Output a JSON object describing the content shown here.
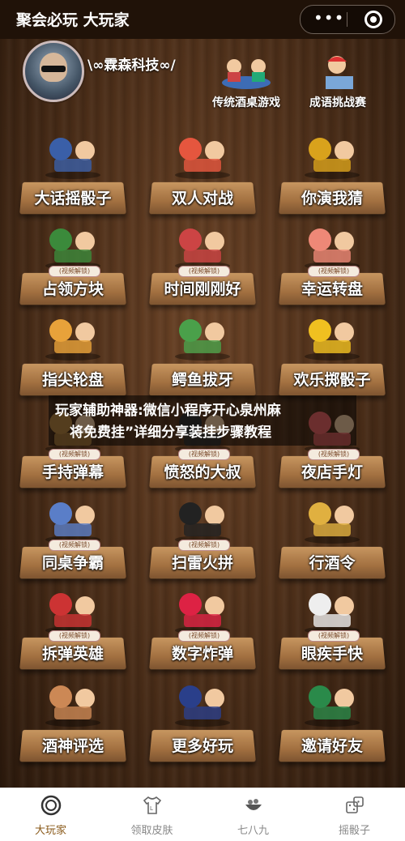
{
  "app": {
    "title": "聚会必玩 大玩家"
  },
  "capsule": {
    "more": "•••"
  },
  "header": {
    "brand": "\\∞霖森科技∞/",
    "top_tiles": [
      {
        "label": "传统酒桌游戏",
        "icon": "drinking-table-icon"
      },
      {
        "label": "成语挑战赛",
        "icon": "idiom-challenge-icon"
      }
    ]
  },
  "badge_text": "(视频解锁)",
  "games": [
    {
      "label": "大话摇骰子",
      "icon": "dice-cup-icon",
      "locked": false
    },
    {
      "label": "双人对战",
      "icon": "fist-bump-icon",
      "locked": false
    },
    {
      "label": "你演我猜",
      "icon": "charades-icon",
      "locked": false
    },
    {
      "label": "占领方块",
      "icon": "soldiers-icon",
      "locked": true
    },
    {
      "label": "时间刚刚好",
      "icon": "alarm-clock-icon",
      "locked": true
    },
    {
      "label": "幸运转盘",
      "icon": "lucky-wheel-icon",
      "locked": true
    },
    {
      "label": "指尖轮盘",
      "icon": "fingertip-icon",
      "locked": false
    },
    {
      "label": "鳄鱼拔牙",
      "icon": "crocodile-icon",
      "locked": false
    },
    {
      "label": "欢乐掷骰子",
      "icon": "dice-roll-icon",
      "locked": false
    },
    {
      "label": "手持弹幕",
      "icon": "handheld-barrage-icon",
      "locked": true
    },
    {
      "label": "愤怒的大叔",
      "icon": "angry-uncle-icon",
      "locked": true
    },
    {
      "label": "夜店手灯",
      "icon": "club-light-icon",
      "locked": true
    },
    {
      "label": "同桌争霸",
      "icon": "desk-mates-icon",
      "locked": true
    },
    {
      "label": "扫雷火拼",
      "icon": "bomb-icon",
      "locked": true
    },
    {
      "label": "行酒令",
      "icon": "beer-glass-icon",
      "locked": false
    },
    {
      "label": "拆弹英雄",
      "icon": "dynamite-icon",
      "locked": true
    },
    {
      "label": "数字炸弹",
      "icon": "number-bomb-icon",
      "locked": true
    },
    {
      "label": "眼疾手快",
      "icon": "eyes-icon",
      "locked": true
    },
    {
      "label": "酒神评选",
      "icon": "voters-icon",
      "locked": false
    },
    {
      "label": "更多好玩",
      "icon": "ninjas-icon",
      "locked": false
    },
    {
      "label": "邀请好友",
      "icon": "friends-icon",
      "locked": false
    }
  ],
  "banner": {
    "line1": "玩家辅助神器:微信小程序开心泉州麻",
    "line2": "将免费挂”详细分享装挂步骤教程"
  },
  "tabs": [
    {
      "label": "大玩家",
      "icon": "target-icon",
      "active": true
    },
    {
      "label": "领取皮肤",
      "icon": "tshirt-icon",
      "active": false
    },
    {
      "label": "七八九",
      "icon": "bowl-icon",
      "active": false
    },
    {
      "label": "摇骰子",
      "icon": "dice-icon",
      "active": false
    }
  ],
  "colors": {
    "active_tab": "#8a5a1a",
    "inactive_tab": "#888888",
    "wood": "#4a2d18"
  }
}
